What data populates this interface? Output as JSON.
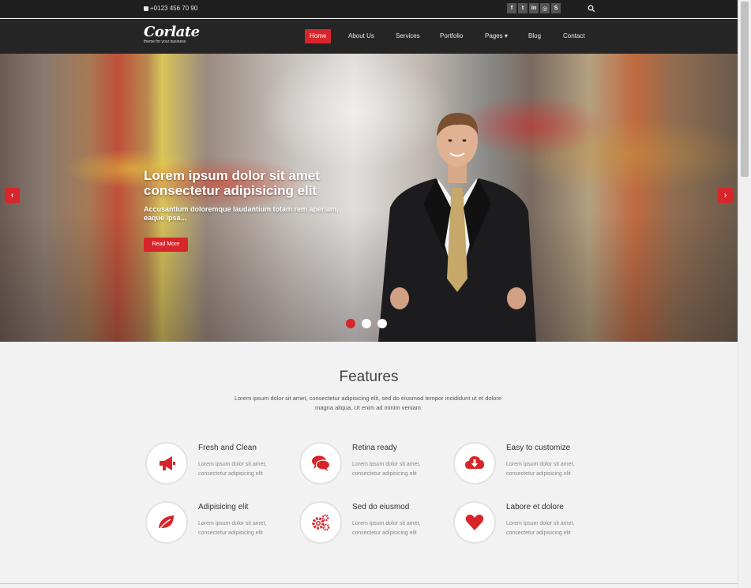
{
  "topbar": {
    "phone": "+0123 456 70 90",
    "social_icons": [
      "facebook-icon",
      "twitter-icon",
      "linkedin-icon",
      "dribbble-icon",
      "skype-icon"
    ],
    "social_glyphs": [
      "f",
      "t",
      "in",
      "◎",
      "S"
    ]
  },
  "brand": {
    "name": "Corlate",
    "tagline": "theme for your business"
  },
  "nav": {
    "items": [
      {
        "label": "Home",
        "active": true
      },
      {
        "label": "About Us"
      },
      {
        "label": "Services"
      },
      {
        "label": "Portfolio"
      },
      {
        "label": "Pages ▾"
      },
      {
        "label": "Blog"
      },
      {
        "label": "Contact"
      }
    ]
  },
  "hero": {
    "title": "Lorem ipsum dolor sit amet consectetur adipisicing elit",
    "subtitle": "Accusantium doloremque laudantium totam rem aperiam, eaque ipsa...",
    "button": "Read More",
    "prev_glyph": "‹",
    "next_glyph": "›",
    "slides": 3,
    "active_slide": 1
  },
  "features": {
    "title": "Features",
    "description": "Lorem ipsum dolor sit amet, consectetur adipisicing elit, sed do eiusmod tempor incididunt ut et dolore magna aliqua. Ut enim ad minim veniam",
    "items": [
      {
        "title": "Fresh and Clean",
        "text": "Lorem ipsum dolor sit amet, consectetur adipisicing elit",
        "icon": "megaphone-icon"
      },
      {
        "title": "Retina ready",
        "text": "Lorem ipsum dolor sit amet, consectetur adipisicing elit",
        "icon": "comments-icon"
      },
      {
        "title": "Easy to customize",
        "text": "Lorem ipsum dolor sit amet, consectetur adipisicing elit",
        "icon": "cloud-download-icon"
      },
      {
        "title": "Adipisicing elit",
        "text": "Lorem ipsum dolor sit amet, consectetur adipisicing elit",
        "icon": "leaf-icon"
      },
      {
        "title": "Sed do eiusmod",
        "text": "Lorem ipsum dolor sit amet, consectetur adipisicing elit",
        "icon": "gears-icon"
      },
      {
        "title": "Labore et dolore",
        "text": "Lorem ipsum dolor sit amet, consectetur adipisicing elit",
        "icon": "heart-icon"
      }
    ]
  },
  "colors": {
    "accent": "#d8252b",
    "topbar": "#1f1f1f",
    "navbar": "#252525",
    "background": "#f2f2f2"
  }
}
